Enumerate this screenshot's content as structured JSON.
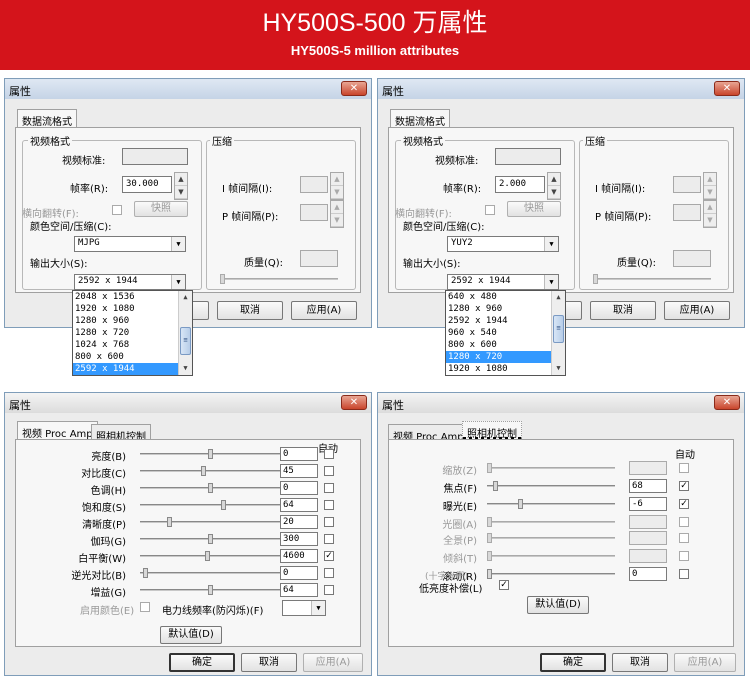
{
  "banner": {
    "title": "HY500S-500 万属性",
    "subtitle": "HY500S-5 million attributes",
    "color": "#d4141b"
  },
  "dialogs": {
    "title": "属性",
    "close_glyph": "✕",
    "ok_label": "确定",
    "cancel_label": "取消",
    "apply_label": "应用(A)"
  },
  "stream_dialog": {
    "tab_label": "数据流格式",
    "video_format_group": "视频格式",
    "video_standard_label": "视频标准:",
    "video_standard_value": "None",
    "frame_rate_label": "帧率(R):",
    "flip_label": "横向翻转(F):",
    "snapshot_label": "快照",
    "color_space_label": "颜色空间/压缩(C):",
    "output_size_label": "输出大小(S):",
    "compression_group": "压缩",
    "i_frame_label": "I 帧间隔(I):",
    "p_frame_label": "P 帧间隔(P):",
    "quality_label": "质量(Q):",
    "cancel_label": "取消",
    "apply_label": "应用(A)"
  },
  "stream_left": {
    "frame_rate": "30.000",
    "color_space": "MJPG",
    "output_size": "2592 x 1944",
    "options": [
      "2048 x 1536",
      "1920 x 1080",
      "1280 x 960",
      "1280 x 720",
      "1024 x 768",
      "800 x 600",
      "2592 x 1944"
    ],
    "selected": "2592 x 1944"
  },
  "stream_right": {
    "frame_rate": "2.000",
    "color_space": "YUY2",
    "output_size": "2592 x 1944",
    "options": [
      "640 x 480",
      "1280 x 960",
      "2592 x 1944",
      "960 x 540",
      "800 x 600",
      "1280 x 720",
      "1920 x 1080"
    ],
    "selected": "1280 x 720"
  },
  "video_proc": {
    "tab_video": "视频 Proc Amp",
    "tab_camera": "照相机控制",
    "auto_header": "自动",
    "rows": [
      {
        "label": "亮度(B)",
        "value": "0",
        "auto": false,
        "level": 0.5
      },
      {
        "label": "对比度(C)",
        "value": "45",
        "auto": false,
        "level": 0.45
      },
      {
        "label": "色调(H)",
        "value": "0",
        "auto": false,
        "level": 0.5
      },
      {
        "label": "饱和度(S)",
        "value": "64",
        "auto": false,
        "level": 0.6
      },
      {
        "label": "清晰度(P)",
        "value": "20",
        "auto": false,
        "level": 0.2
      },
      {
        "label": "伽玛(G)",
        "value": "300",
        "auto": false,
        "level": 0.5
      },
      {
        "label": "白平衡(W)",
        "value": "4600",
        "auto": true,
        "level": 0.48
      },
      {
        "label": "逆光对比(B)",
        "value": "0",
        "auto": false,
        "level": 0.02
      },
      {
        "label": "增益(G)",
        "value": "64",
        "auto": false,
        "level": 0.5
      }
    ],
    "enable_color_label": "启用颜色(E)",
    "power_freq_label": "电力线频率(防闪烁)(F)",
    "power_freq_value": "",
    "default_label": "默认值(D)",
    "ok_label": "确定",
    "cancel_label": "取消",
    "apply_label": "应用(A)"
  },
  "camera_ctrl": {
    "tab_video": "视频 Proc Amp",
    "tab_camera": "照相机控制",
    "auto_header": "自动",
    "rows": [
      {
        "label": "缩放(Z)",
        "value": "",
        "auto": false,
        "disabled": true,
        "level": 0.0
      },
      {
        "label": "焦点(F)",
        "value": "68",
        "auto": true,
        "disabled": false,
        "level": 0.05
      },
      {
        "label": "曝光(E)",
        "value": "-6",
        "auto": true,
        "disabled": false,
        "level": 0.25
      },
      {
        "label": "光圈(A)",
        "value": "",
        "auto": false,
        "disabled": true,
        "level": 0.0
      },
      {
        "label": "全景(P)",
        "value": "",
        "auto": false,
        "disabled": true,
        "level": 0.0
      },
      {
        "label": "倾斜(T)",
        "value": "",
        "auto": false,
        "disabled": true,
        "level": 0.0
      },
      {
        "label": "滚动(R)",
        "value": "0",
        "auto": false,
        "disabled": false,
        "level": 0.0
      }
    ],
    "iris_sub_label": "(十字光栅)",
    "low_light_label": "低亮度补偿(L)",
    "low_light_checked": true,
    "default_label": "默认值(D)",
    "ok_label": "确定",
    "cancel_label": "取消",
    "apply_label": "应用(A)"
  }
}
